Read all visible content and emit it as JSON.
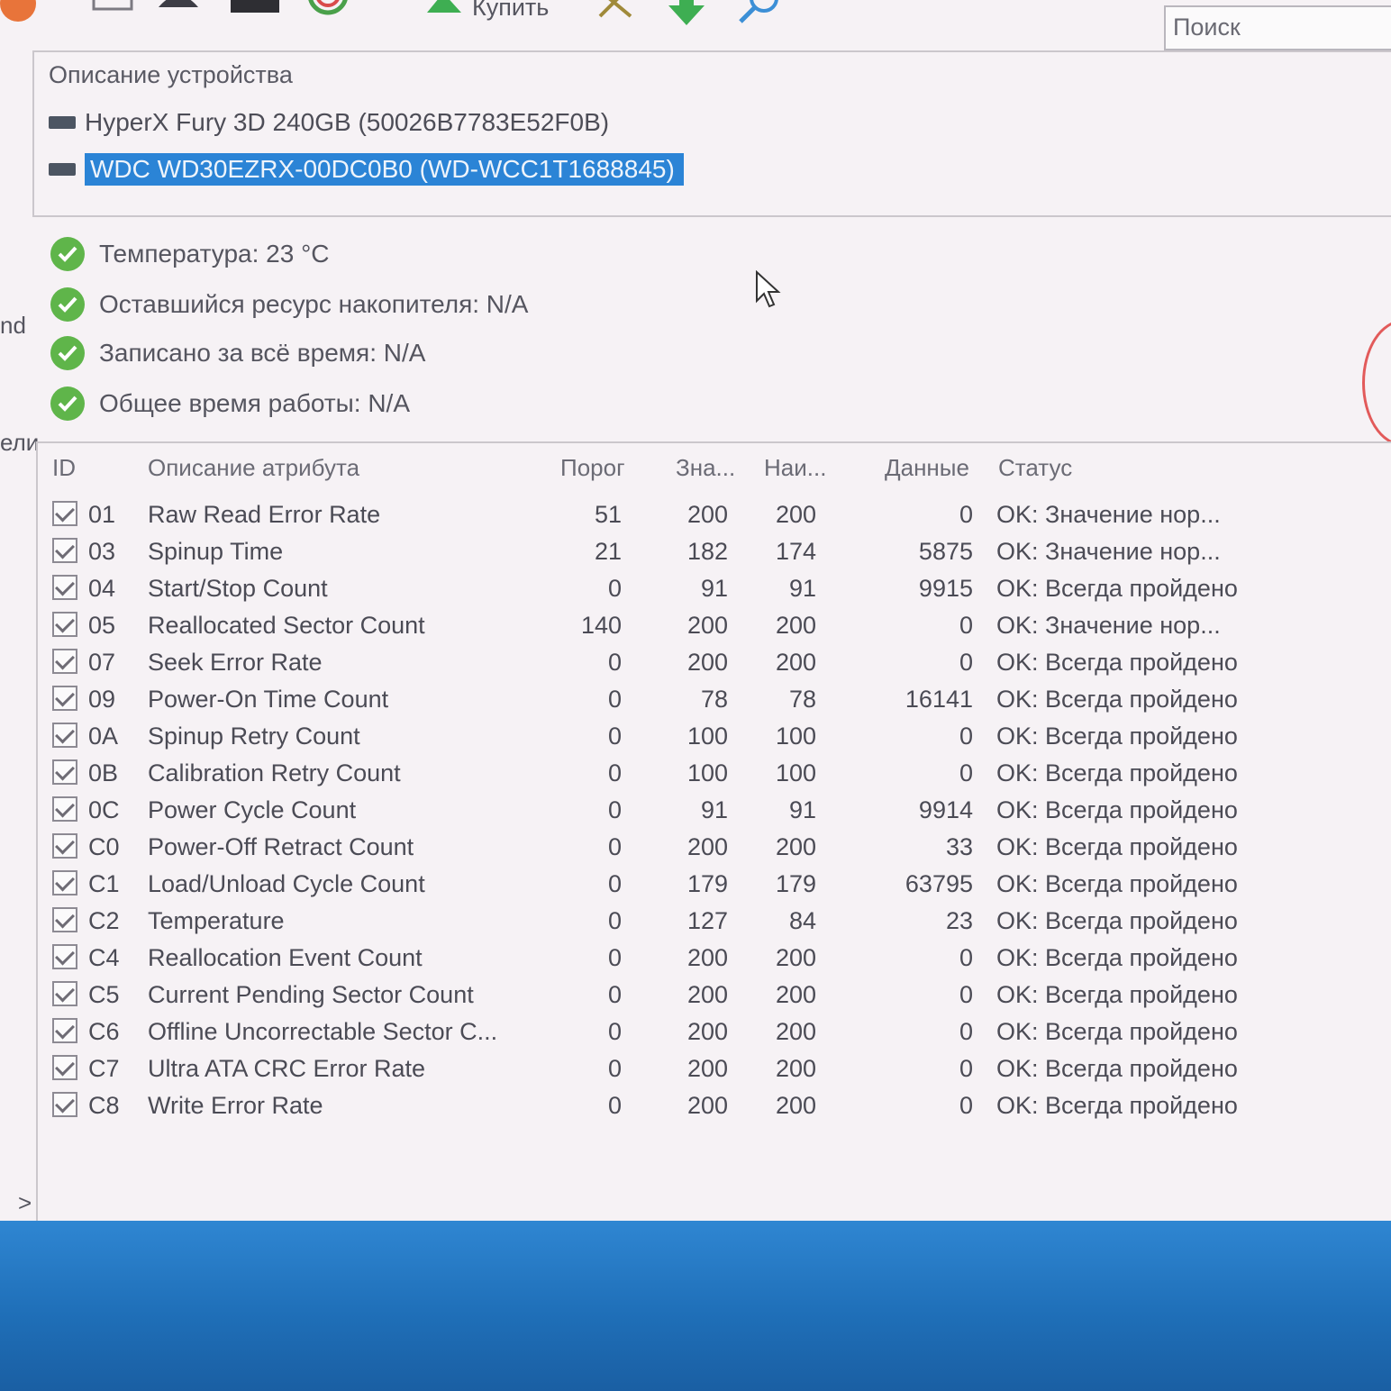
{
  "toolbar": {
    "buy_label": "Купить",
    "search_placeholder": "Поиск"
  },
  "devices": {
    "title": "Описание устройства",
    "items": [
      {
        "label": "HyperX Fury 3D 240GB (50026B7783E52F0B)",
        "selected": false
      },
      {
        "label": "WDC WD30EZRX-00DC0B0 (WD-WCC1T1688845)",
        "selected": true
      }
    ]
  },
  "status": [
    {
      "label": "Температура: 23 °C"
    },
    {
      "label": "Оставшийся ресурс накопителя: N/A"
    },
    {
      "label": "Записано за всё время: N/A"
    },
    {
      "label": "Общее время работы: N/A"
    }
  ],
  "side_fragments": [
    "nd",
    "ели"
  ],
  "attributes": {
    "headers": {
      "id": "ID",
      "desc": "Описание атрибута",
      "threshold": "Порог",
      "value": "Зна...",
      "worst": "Наи...",
      "data": "Данные",
      "status": "Статус"
    },
    "rows": [
      {
        "id": "01",
        "desc": "Raw Read Error Rate",
        "threshold": "51",
        "value": "200",
        "worst": "200",
        "data": "0",
        "status": "OK: Значение нор..."
      },
      {
        "id": "03",
        "desc": "Spinup Time",
        "threshold": "21",
        "value": "182",
        "worst": "174",
        "data": "5875",
        "status": "OK: Значение нор..."
      },
      {
        "id": "04",
        "desc": "Start/Stop Count",
        "threshold": "0",
        "value": "91",
        "worst": "91",
        "data": "9915",
        "status": "OK: Всегда пройдено"
      },
      {
        "id": "05",
        "desc": "Reallocated Sector Count",
        "threshold": "140",
        "value": "200",
        "worst": "200",
        "data": "0",
        "status": "OK: Значение нор..."
      },
      {
        "id": "07",
        "desc": "Seek Error Rate",
        "threshold": "0",
        "value": "200",
        "worst": "200",
        "data": "0",
        "status": "OK: Всегда пройдено"
      },
      {
        "id": "09",
        "desc": "Power-On Time Count",
        "threshold": "0",
        "value": "78",
        "worst": "78",
        "data": "16141",
        "status": "OK: Всегда пройдено"
      },
      {
        "id": "0A",
        "desc": "Spinup Retry Count",
        "threshold": "0",
        "value": "100",
        "worst": "100",
        "data": "0",
        "status": "OK: Всегда пройдено"
      },
      {
        "id": "0B",
        "desc": "Calibration Retry Count",
        "threshold": "0",
        "value": "100",
        "worst": "100",
        "data": "0",
        "status": "OK: Всегда пройдено"
      },
      {
        "id": "0C",
        "desc": "Power Cycle Count",
        "threshold": "0",
        "value": "91",
        "worst": "91",
        "data": "9914",
        "status": "OK: Всегда пройдено"
      },
      {
        "id": "C0",
        "desc": "Power-Off Retract Count",
        "threshold": "0",
        "value": "200",
        "worst": "200",
        "data": "33",
        "status": "OK: Всегда пройдено"
      },
      {
        "id": "C1",
        "desc": "Load/Unload Cycle Count",
        "threshold": "0",
        "value": "179",
        "worst": "179",
        "data": "63795",
        "status": "OK: Всегда пройдено"
      },
      {
        "id": "C2",
        "desc": "Temperature",
        "threshold": "0",
        "value": "127",
        "worst": "84",
        "data": "23",
        "status": "OK: Всегда пройдено"
      },
      {
        "id": "C4",
        "desc": "Reallocation Event Count",
        "threshold": "0",
        "value": "200",
        "worst": "200",
        "data": "0",
        "status": "OK: Всегда пройдено"
      },
      {
        "id": "C5",
        "desc": "Current Pending Sector Count",
        "threshold": "0",
        "value": "200",
        "worst": "200",
        "data": "0",
        "status": "OK: Всегда пройдено"
      },
      {
        "id": "C6",
        "desc": "Offline Uncorrectable Sector C...",
        "threshold": "0",
        "value": "200",
        "worst": "200",
        "data": "0",
        "status": "OK: Всегда пройдено"
      },
      {
        "id": "C7",
        "desc": "Ultra ATA CRC Error Rate",
        "threshold": "0",
        "value": "200",
        "worst": "200",
        "data": "0",
        "status": "OK: Всегда пройдено"
      },
      {
        "id": "C8",
        "desc": "Write Error Rate",
        "threshold": "0",
        "value": "200",
        "worst": "200",
        "data": "0",
        "status": "OK: Всегда пройдено"
      }
    ]
  },
  "expander_glyph": ">",
  "colors": {
    "selection": "#2b84d6",
    "ok_green": "#5fb54a",
    "desktop_blue": "#2a7fc9"
  }
}
